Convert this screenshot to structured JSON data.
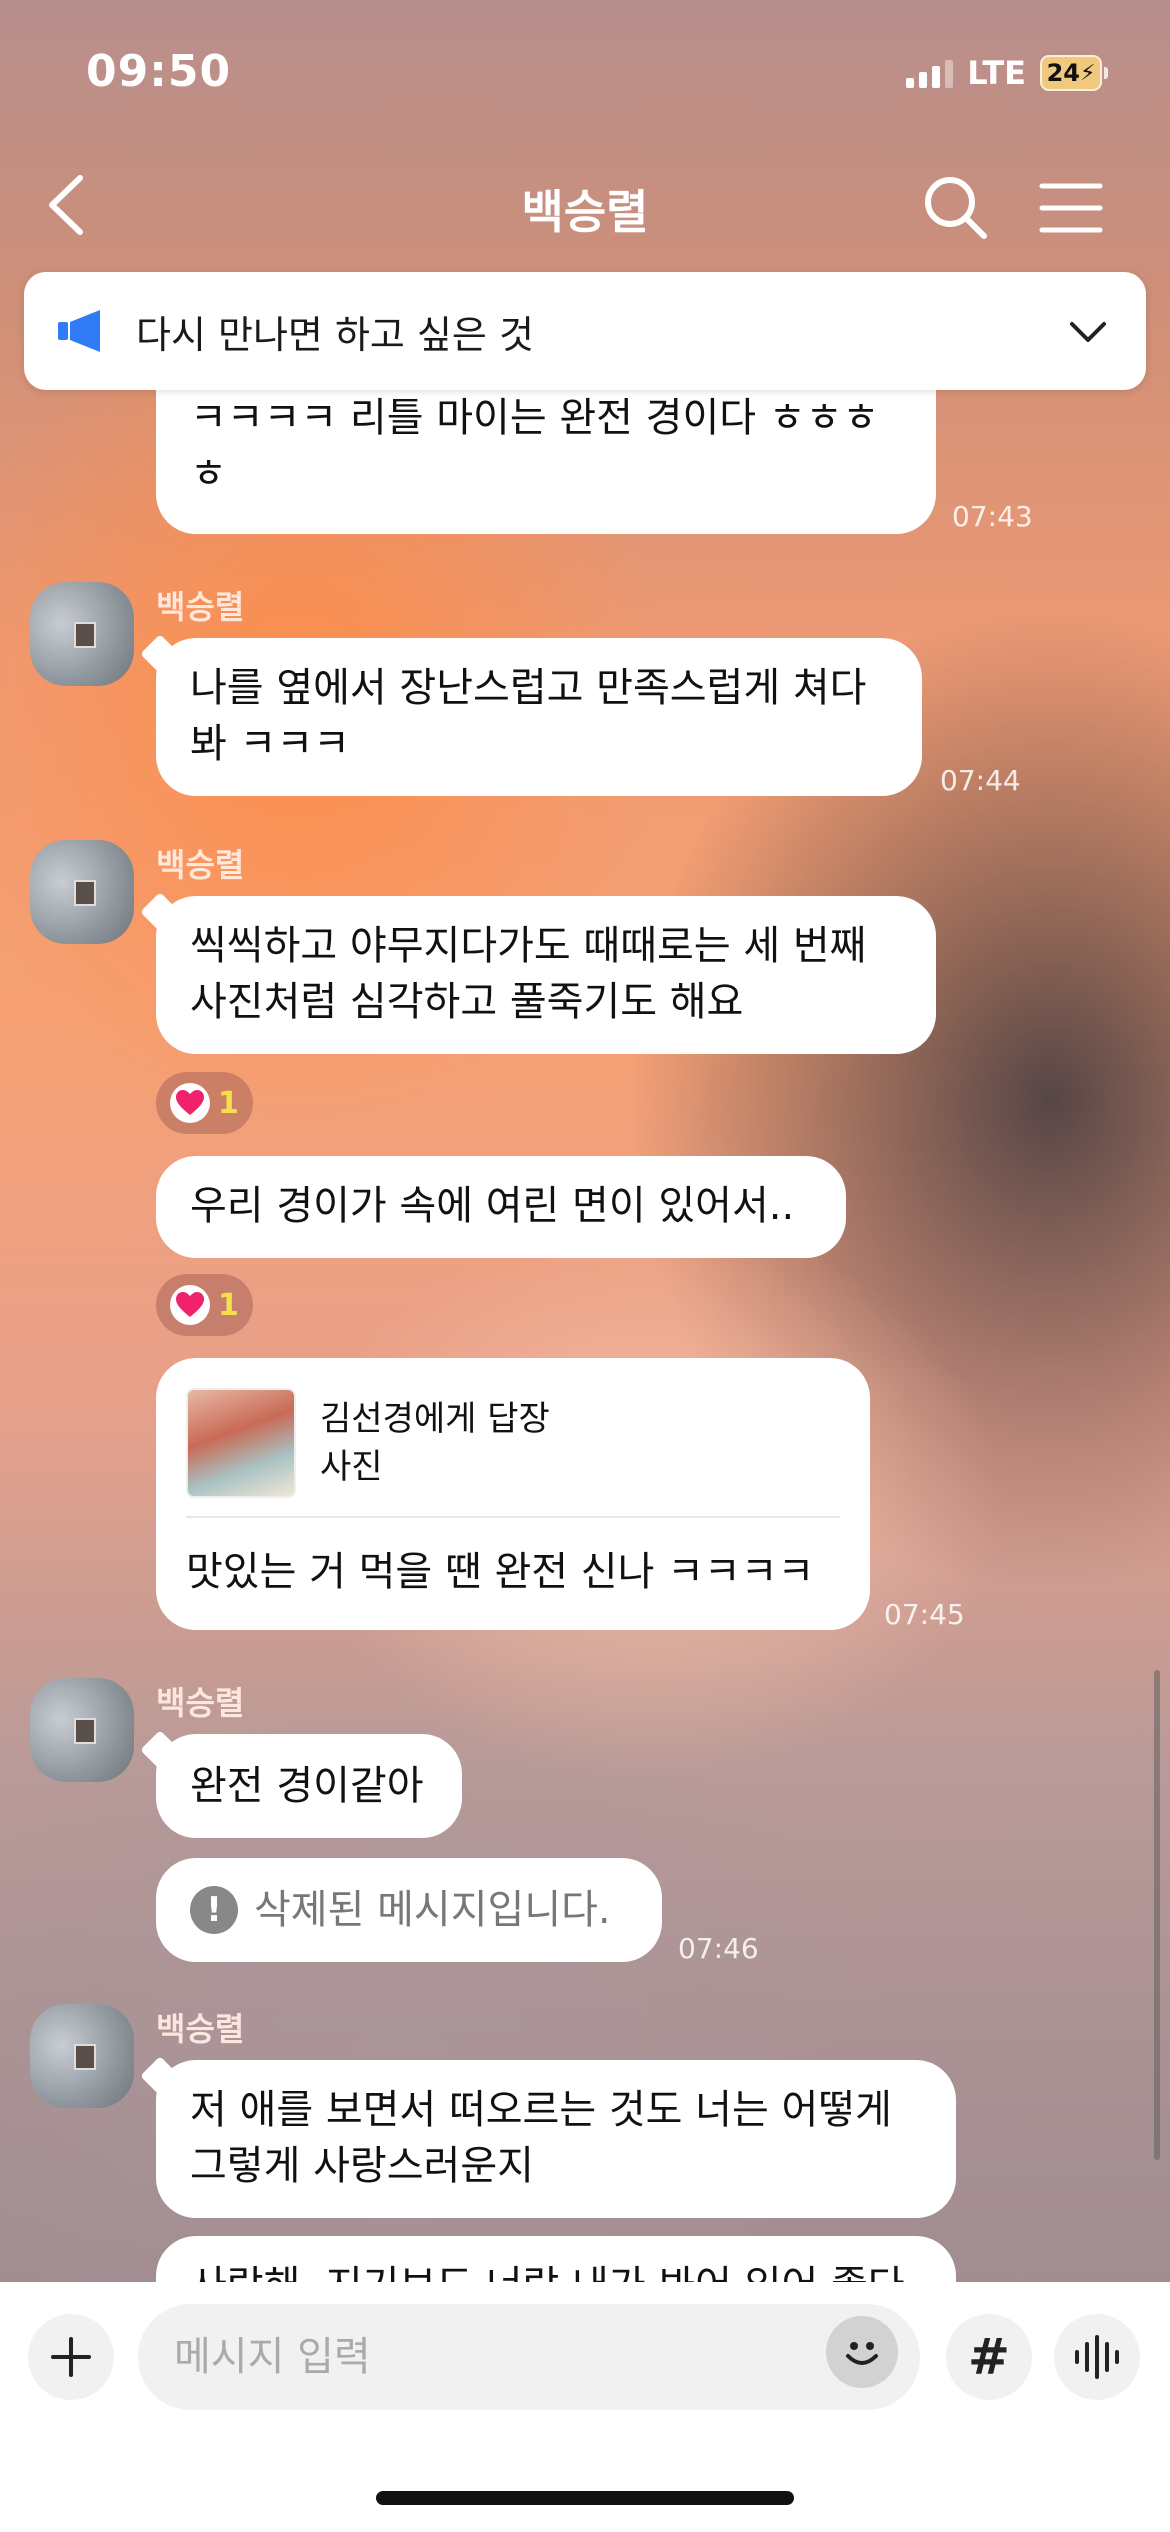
{
  "status_bar": {
    "time": "09:50",
    "network": "LTE",
    "battery": "24"
  },
  "header": {
    "title": "백승렬",
    "back_icon": "chevron-left-icon",
    "search_icon": "search-icon",
    "menu_icon": "menu-icon"
  },
  "notice": {
    "text": "다시 만나면 하고 싶은 것",
    "icon": "megaphone-icon",
    "chevron": "chevron-down-icon"
  },
  "messages": {
    "m1": {
      "line1": "ㅋㅋㅋㅋ 리틀 마이는 완전 경이다 ㅎㅎㅎ",
      "line2": "ㅎ",
      "time": "07:43"
    },
    "g2": {
      "sender": "백승렬",
      "m2": {
        "line1": "나를 옆에서 장난스럽고 만족스럽게 쳐다",
        "line2": "봐 ㅋㅋㅋ",
        "time": "07:44"
      }
    },
    "g3": {
      "sender": "백승렬",
      "m3": {
        "line1": "씩씩하고 야무지다가도 때때로는 세 번째",
        "line2": "사진처럼 심각하고 풀죽기도 해요",
        "reaction_count": "1"
      },
      "m4": {
        "text": "우리 경이가 속에 여린 면이 있어서..",
        "reaction_count": "1"
      },
      "m5": {
        "reply_to": "김선경에게 답장",
        "reply_type": "사진",
        "text": "맛있는 거 먹을 땐 완전 신나 ㅋㅋㅋㅋ",
        "time": "07:45"
      }
    },
    "g4": {
      "sender": "백승렬",
      "m6": {
        "text": "완전 경이같아"
      },
      "m7": {
        "text": "삭제된 메시지입니다.",
        "icon": "!",
        "time": "07:46"
      }
    },
    "g5": {
      "sender": "백승렬",
      "m8": {
        "line1": "저 애를 보면서 떠오르는 것도 너는 어떻게",
        "line2": "그렇게 사랑스러운지"
      },
      "m9": {
        "partial": "사랑해. 지기보도 너랑 내가 봐어 있어 좋다"
      }
    }
  },
  "input": {
    "placeholder": "메시지 입력",
    "plus_icon": "plus-icon",
    "emoji_icon": "emoji-icon",
    "hashtag_label": "#",
    "voice_icon": "voice-icon"
  },
  "colors": {
    "bubble": "#ffffff",
    "accent_blue": "#2f7cf6",
    "heart": "#f0226b",
    "reaction_count": "#f5e04a"
  }
}
